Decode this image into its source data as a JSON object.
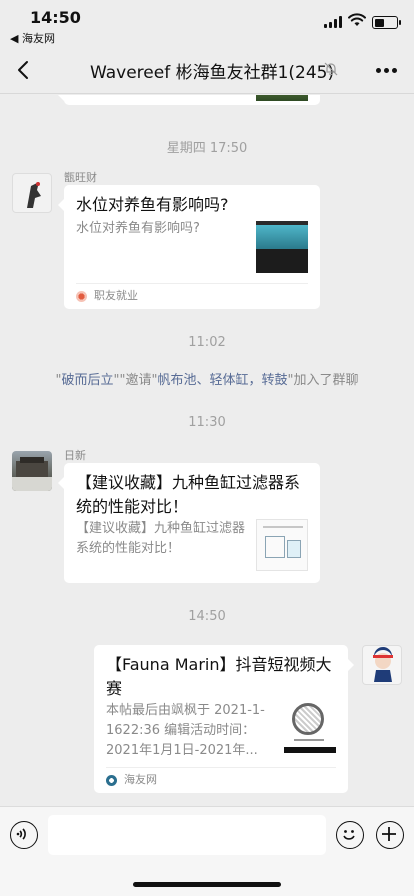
{
  "status_bar": {
    "time": "14:50",
    "back_app": "◀ 海友网"
  },
  "nav": {
    "title": "Wavereef 彬海鱼友社群1(245)"
  },
  "messages": {
    "time_thu": "星期四 17:50",
    "msg1": {
      "sender": "甑旺财",
      "title": "水位对养鱼有影响吗?",
      "desc": "水位对养鱼有影响吗?",
      "source": "职友就业"
    },
    "time_1102": "11:02",
    "system": {
      "q1": "\"",
      "name1": "破而后立",
      "q2": "\"\"",
      "verb1": "邀请",
      "q3": "\"",
      "names2": "帆布池、轻体缸，转鼓",
      "q4": "\"",
      "action": "加入了群聊"
    },
    "time_1130": "11:30",
    "msg2": {
      "sender": "日新",
      "title": "【建议收藏】九种鱼缸过滤器系统的性能对比！",
      "desc": "【建议收藏】九种鱼缸过滤器系统的性能对比！"
    },
    "time_1450": "14:50",
    "msg3": {
      "title": "【Fauna Marin】抖音短视频大赛",
      "desc": "本帖最后由飒枫于 2021-1-1622:36 编辑活动时间：2021年1月1日-2021年...",
      "source": "海友网"
    }
  },
  "colors": {
    "background": "#ededed",
    "link": "#576b95",
    "bubble": "#ffffff"
  }
}
